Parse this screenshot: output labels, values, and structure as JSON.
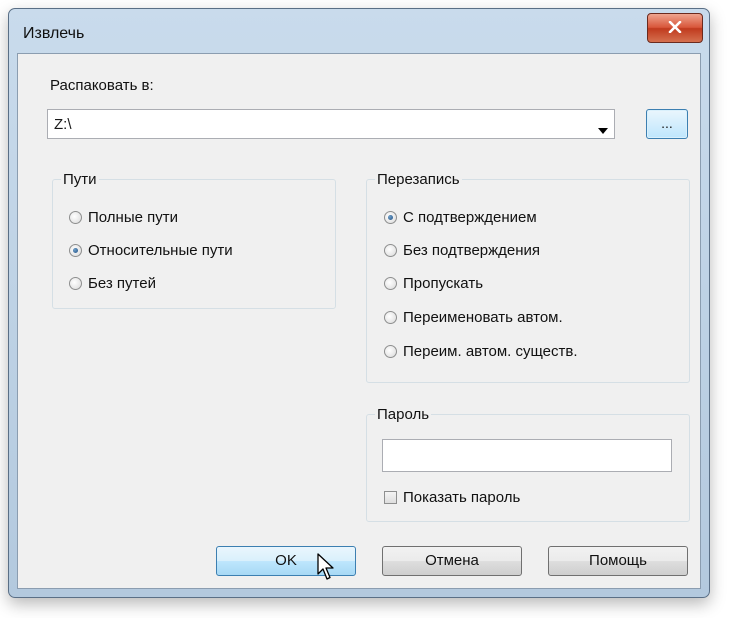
{
  "window": {
    "title": "Извлечь"
  },
  "extract_to": {
    "label": "Распаковать в:",
    "path_value": "Z:\\",
    "browse_label": "..."
  },
  "paths_group": {
    "legend": "Пути",
    "options": [
      {
        "label": "Полные пути",
        "checked": false
      },
      {
        "label": "Относительные пути",
        "checked": true
      },
      {
        "label": "Без путей",
        "checked": false
      }
    ]
  },
  "overwrite_group": {
    "legend": "Перезапись",
    "options": [
      {
        "label": "С подтверждением",
        "checked": true
      },
      {
        "label": "Без подтверждения",
        "checked": false
      },
      {
        "label": "Пропускать",
        "checked": false
      },
      {
        "label": "Переименовать автом.",
        "checked": false
      },
      {
        "label": "Переим. автом. существ.",
        "checked": false
      }
    ]
  },
  "password_group": {
    "legend": "Пароль",
    "value": "",
    "show_password_label": "Показать пароль",
    "show_password_checked": false
  },
  "buttons": {
    "ok": "OK",
    "cancel": "Отмена",
    "help": "Помощь"
  }
}
